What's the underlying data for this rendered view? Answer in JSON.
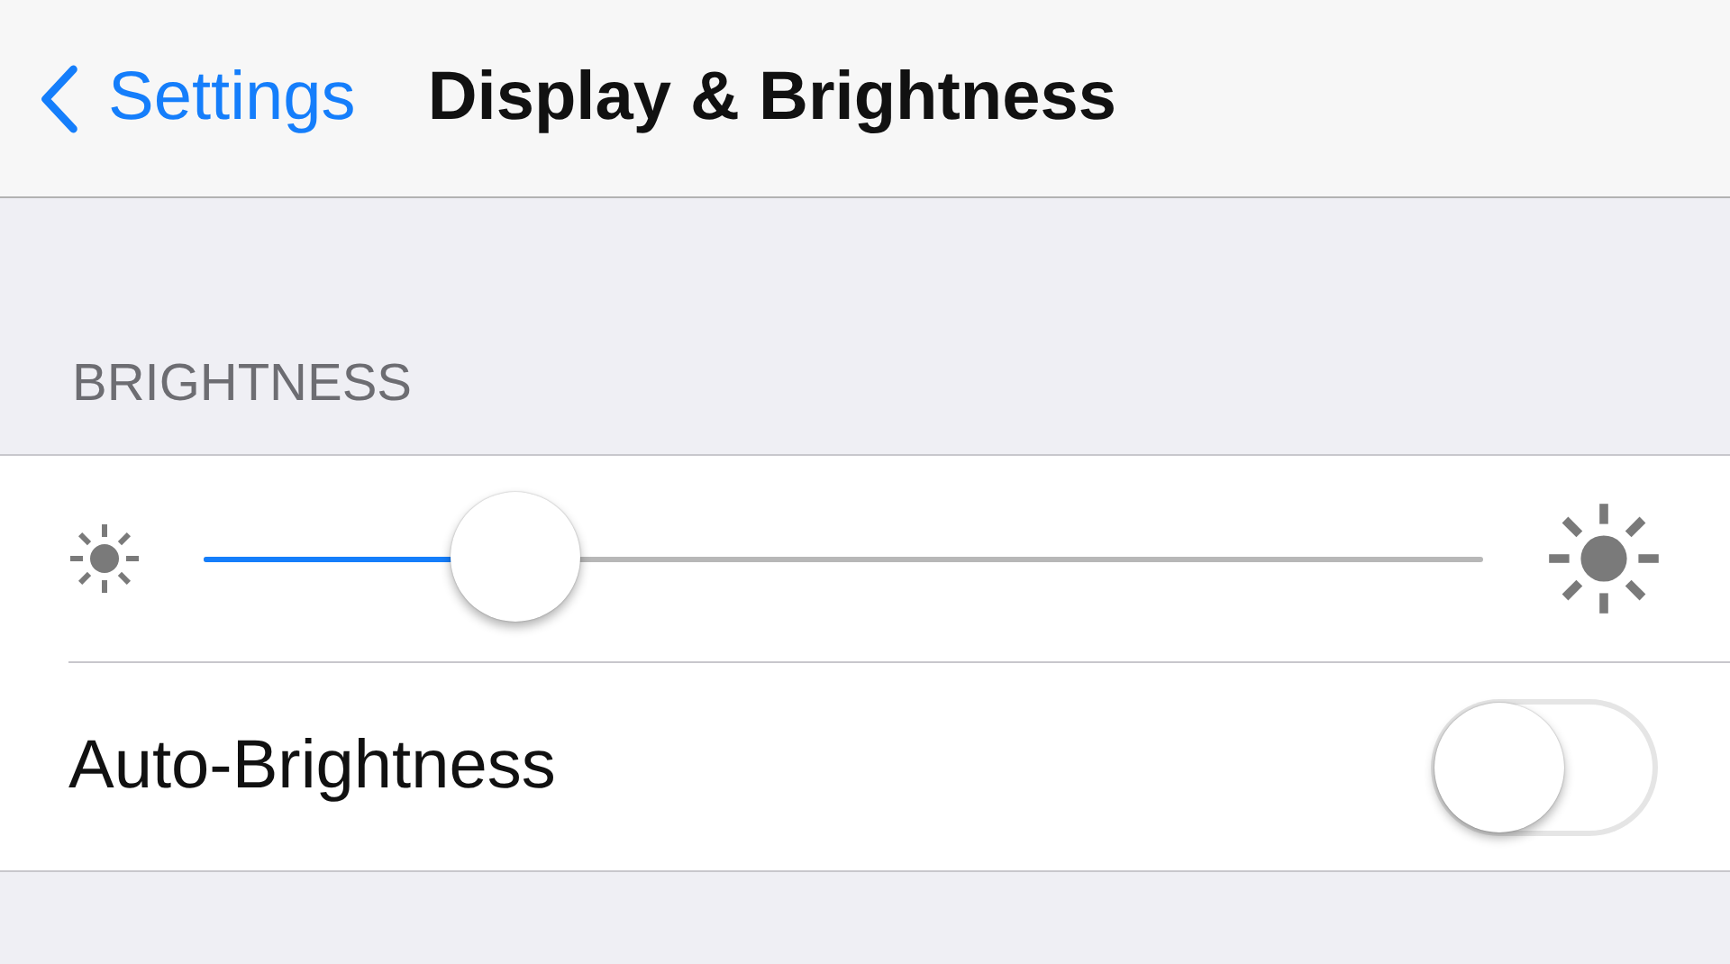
{
  "nav": {
    "back": {
      "label": "Settings"
    },
    "title": "Display & Brightness"
  },
  "sections": [
    {
      "header": "BRIGHTNESS",
      "rows": [
        {
          "kind": "slider",
          "level": 0.244
        },
        {
          "kind": "toggle",
          "label": "Auto-Brightness",
          "on": false
        }
      ]
    }
  ]
}
